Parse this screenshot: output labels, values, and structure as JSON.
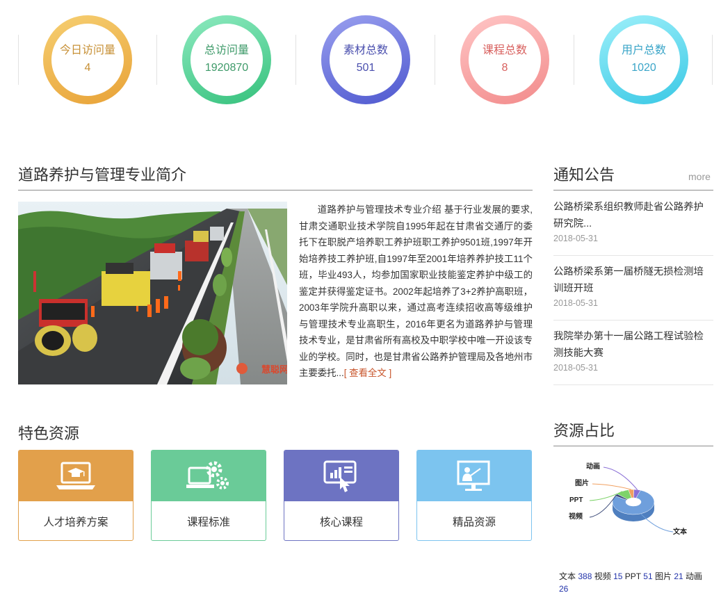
{
  "stats": [
    {
      "label": "今日访问量",
      "value": "4",
      "color": "#c79036",
      "ring_from": "#f6cf72",
      "ring_to": "#e8a237"
    },
    {
      "label": "总访问量",
      "value": "1920870",
      "color": "#3e9a69",
      "ring_from": "#8eeac0",
      "ring_to": "#35c17c"
    },
    {
      "label": "素材总数",
      "value": "501",
      "color": "#4a4fae",
      "ring_from": "#9aa0ef",
      "ring_to": "#4e58cf"
    },
    {
      "label": "课程总数",
      "value": "8",
      "color": "#d8605e",
      "ring_from": "#ffc6c6",
      "ring_to": "#f28b8b"
    },
    {
      "label": "用户总数",
      "value": "1020",
      "color": "#3aa5c8",
      "ring_from": "#9ef0fa",
      "ring_to": "#39c8e5"
    }
  ],
  "intro": {
    "title": "道路养护与管理专业简介",
    "text": "道路养护与管理技术专业介绍 基于行业发展的要求,甘肃交通职业技术学院自1995年起在甘肃省交通厅的委托下在职脱产培养职工养护班职工养护9501班,1997年开始培养技工养护班,自1997年至2001年培养养护技工11个班，毕业493人，均参加国家职业技能鉴定养护中级工的鉴定并获得鉴定证书。2002年起培养了3+2养护高职班，2003年学院升高职以来，通过高考连续招收高等级维护与管理技术专业高职生，2016年更名为道路养护与管理技术专业，是甘肃省所有高校及中职学校中唯一开设该专业的学校。同时，也是甘肃省公路养护管理局及各地州市主要委托...",
    "more": "[ 查看全文 ]",
    "watermark": "慧聪网"
  },
  "notice": {
    "title": "通知公告",
    "more": "more",
    "items": [
      {
        "title": "公路桥梁系组织教师赴省公路养护研究院...",
        "date": "2018-05-31"
      },
      {
        "title": "公路桥梁系第一届桥隧无损检测培训班开班",
        "date": "2018-05-31"
      },
      {
        "title": "我院举办第十一届公路工程试验检测技能大赛",
        "date": "2018-05-31"
      }
    ]
  },
  "features": {
    "title": "特色资源",
    "cards": [
      {
        "label": "人才培养方案",
        "color": "#e2a04b",
        "icon": "laptop-graduation-icon"
      },
      {
        "label": "课程标准",
        "color": "#6acb98",
        "icon": "laptop-gears-icon"
      },
      {
        "label": "核心课程",
        "color": "#6d73c2",
        "icon": "tablet-chart-touch-icon"
      },
      {
        "label": "精品资源",
        "color": "#7cc4ef",
        "icon": "presentation-teacher-icon"
      }
    ]
  },
  "resources": {
    "title": "资源占比",
    "summary": [
      {
        "label": "文本",
        "value": "388"
      },
      {
        "label": "视频",
        "value": "15"
      },
      {
        "label": "PPT",
        "value": "51"
      },
      {
        "label": "图片",
        "value": "21"
      },
      {
        "label": "动画",
        "value": "26"
      }
    ]
  },
  "chart_data": {
    "type": "pie",
    "categories": [
      "文本",
      "视频",
      "PPT",
      "图片",
      "动画"
    ],
    "values": [
      388,
      15,
      51,
      21,
      26
    ],
    "colors": [
      "#6f9fdc",
      "#3d4c7a",
      "#7ed36a",
      "#f1a060",
      "#8a6fd6"
    ],
    "title": ""
  }
}
